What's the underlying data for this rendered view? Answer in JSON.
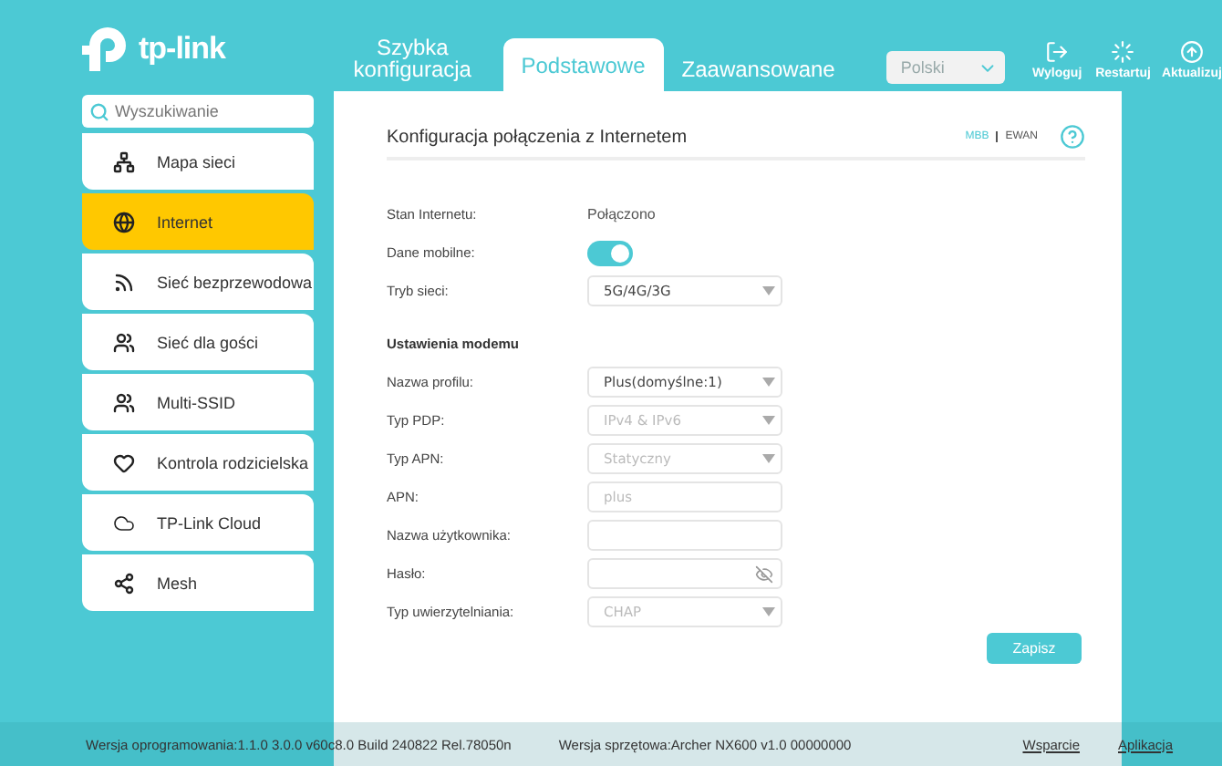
{
  "brand": "tp-link",
  "tabs": [
    {
      "label": "Szybka konfiguracja",
      "selected": false
    },
    {
      "label": "Podstawowe",
      "selected": true
    },
    {
      "label": "Zaawansowane",
      "selected": false
    }
  ],
  "language": {
    "value": "Polski"
  },
  "actions": [
    {
      "label": "Wyloguj",
      "kind": "logout"
    },
    {
      "label": "Restartuj",
      "kind": "restart"
    },
    {
      "label": "Aktualizuj",
      "kind": "update"
    }
  ],
  "search": {
    "placeholder": "Wyszukiwanie"
  },
  "sidebar": {
    "items": [
      {
        "label": "Mapa sieci",
        "kind": "map",
        "selected": false
      },
      {
        "label": "Internet",
        "kind": "globe",
        "selected": true
      },
      {
        "label": "Sieć bezprzewodowa",
        "kind": "wireless",
        "selected": false
      },
      {
        "label": "Sieć dla gości",
        "kind": "guests",
        "selected": false
      },
      {
        "label": "Multi-SSID",
        "kind": "guests",
        "selected": false
      },
      {
        "label": "Kontrola rodzicielska",
        "kind": "heart",
        "selected": false
      },
      {
        "label": "TP-Link Cloud",
        "kind": "cloud",
        "selected": false
      },
      {
        "label": "Mesh",
        "kind": "mesh",
        "selected": false
      }
    ]
  },
  "panel": {
    "title": "Konfiguracja połączenia z Internetem",
    "modes": [
      {
        "label": "MBB",
        "selected": true
      },
      {
        "label": "EWAN",
        "selected": false
      }
    ],
    "rows": [
      {
        "kind": "text",
        "label": "Stan Internetu:",
        "value": "Połączono"
      },
      {
        "kind": "toggle",
        "label": "Dane mobilne:",
        "on": true
      },
      {
        "kind": "select",
        "label": "Tryb sieci:",
        "value": "5G/4G/3G",
        "disabled": false
      },
      {
        "kind": "heading",
        "label": "Ustawienia modemu"
      },
      {
        "kind": "select",
        "label": "Nazwa profilu:",
        "value": "Plus(domyślne:1)",
        "disabled": false
      },
      {
        "kind": "select",
        "label": "Typ PDP:",
        "value": "IPv4 & IPv6",
        "disabled": true
      },
      {
        "kind": "select",
        "label": "Typ APN:",
        "value": "Statyczny",
        "disabled": true
      },
      {
        "kind": "input",
        "label": "APN:",
        "value": "plus",
        "disabled": true
      },
      {
        "kind": "input",
        "label": "Nazwa użytkownika:"
      },
      {
        "kind": "password",
        "label": "Hasło:"
      },
      {
        "kind": "select",
        "label": "Typ uwierzytelniania:",
        "value": "CHAP",
        "disabled": true
      }
    ],
    "save": "Zapisz"
  },
  "footer": {
    "firmware": "Wersja oprogramowania:1.1.0 3.0.0 v60c8.0 Build 240822 Rel.78050n",
    "hardware": "Wersja sprzętowa:Archer NX600 v1.0 00000000",
    "links": [
      "Wsparcie",
      "Aplikacja"
    ]
  }
}
